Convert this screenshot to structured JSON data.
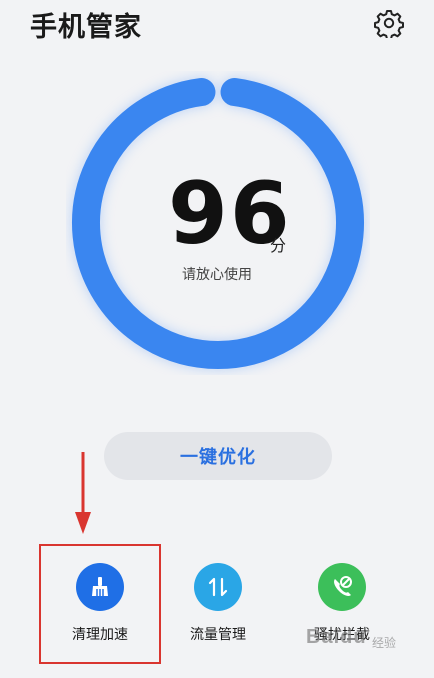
{
  "header": {
    "title": "手机管家",
    "settings_icon": "gear-icon"
  },
  "score": {
    "value": "96",
    "unit": "分",
    "status": "请放心使用",
    "ring_fraction": 0.96
  },
  "optimize_button": {
    "label": "一键优化"
  },
  "tools": [
    {
      "label": "清理加速",
      "icon": "broom-icon",
      "color": "#1f6fe6"
    },
    {
      "label": "流量管理",
      "icon": "data-traffic-icon",
      "color": "#2aa6e6"
    },
    {
      "label": "骚扰拦截",
      "icon": "block-call-icon",
      "color": "#3cbf5a"
    }
  ],
  "colors": {
    "accent": "#2a70e0",
    "ring": "#3a86f0",
    "annotation": "#d9352f"
  },
  "watermark": {
    "text": "Baidu",
    "sub": "经验"
  }
}
